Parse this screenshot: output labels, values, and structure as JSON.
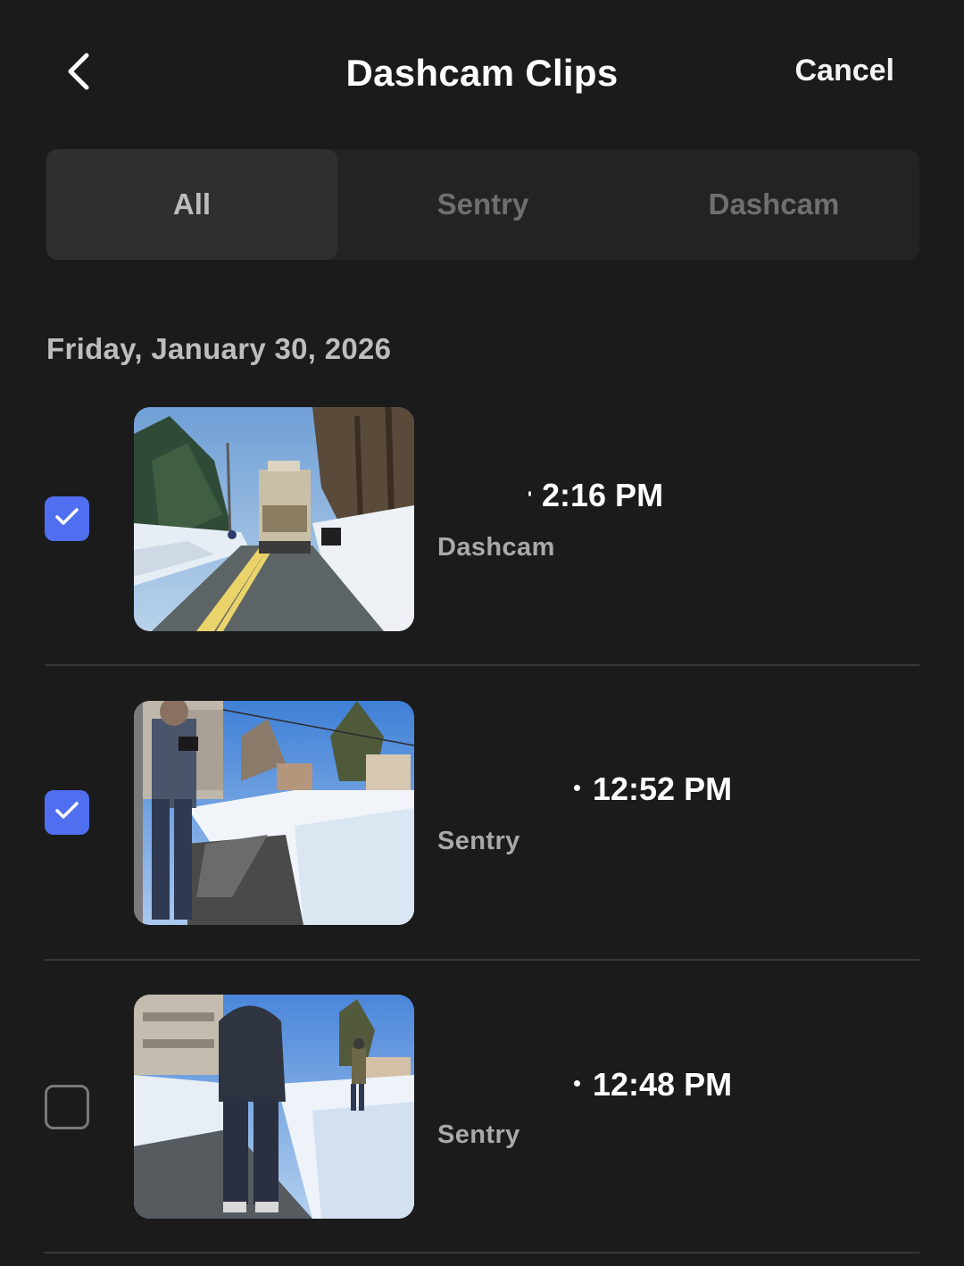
{
  "header": {
    "title": "Dashcam Clips",
    "back_icon": "chevron-left-icon",
    "cancel_label": "Cancel"
  },
  "filter_tabs": [
    {
      "label": "All",
      "active": true
    },
    {
      "label": "Sentry",
      "active": false
    },
    {
      "label": "Dashcam",
      "active": false
    }
  ],
  "date_group": "Friday, January 30, 2026",
  "clips": [
    {
      "time": "2:16 PM",
      "type": "Dashcam",
      "checked": true,
      "thumbnail": "street-with-truck"
    },
    {
      "time": "12:52 PM",
      "type": "Sentry",
      "checked": true,
      "thumbnail": "person-on-snowy-sidewalk"
    },
    {
      "time": "12:48 PM",
      "type": "Sentry",
      "checked": false,
      "thumbnail": "person-walking-away-in-snow"
    }
  ],
  "colors": {
    "background": "#1b1b1c",
    "checkbox_checked": "#4f6ff0",
    "tab_active_bg": "#2f2f31",
    "divider": "#38383a"
  }
}
